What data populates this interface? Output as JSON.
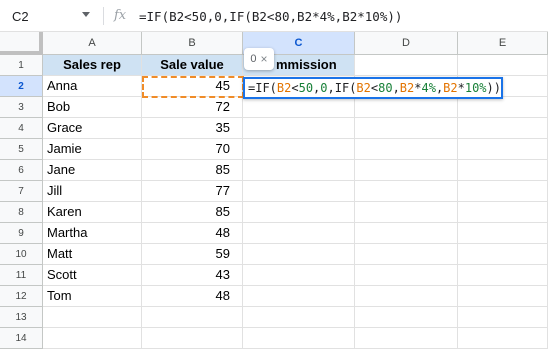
{
  "formula_bar": {
    "cell_ref": "C2",
    "fx_label": "fx",
    "formula": "=IF(B2<50,0,IF(B2<80,B2*4%,B2*10%))"
  },
  "columns": [
    "A",
    "B",
    "C",
    "D",
    "E"
  ],
  "rows": [
    "1",
    "2",
    "3",
    "4",
    "5",
    "6",
    "7",
    "8",
    "9",
    "10",
    "11",
    "12",
    "13",
    "14"
  ],
  "active": {
    "column": "C",
    "row": "2"
  },
  "table": {
    "headers": [
      "Sales rep",
      "Sale value",
      "Commission"
    ],
    "commission_header_visible": "mmission",
    "data": [
      [
        "Anna",
        "45"
      ],
      [
        "Bob",
        "72"
      ],
      [
        "Grace",
        "35"
      ],
      [
        "Jamie",
        "70"
      ],
      [
        "Jane",
        "85"
      ],
      [
        "Jill",
        "77"
      ],
      [
        "Karen",
        "85"
      ],
      [
        "Martha",
        "48"
      ],
      [
        "Matt",
        "59"
      ],
      [
        "Scott",
        "43"
      ],
      [
        "Tom",
        "48"
      ]
    ]
  },
  "editor": {
    "tokens": [
      {
        "t": "=IF(",
        "k": "plain"
      },
      {
        "t": "B2",
        "k": "ref"
      },
      {
        "t": "<",
        "k": "plain"
      },
      {
        "t": "50",
        "k": "num"
      },
      {
        "t": ",",
        "k": "plain"
      },
      {
        "t": "0",
        "k": "num"
      },
      {
        "t": ",IF(",
        "k": "plain"
      },
      {
        "t": "B2",
        "k": "ref"
      },
      {
        "t": "<",
        "k": "plain"
      },
      {
        "t": "80",
        "k": "num"
      },
      {
        "t": ",",
        "k": "plain"
      },
      {
        "t": "B2",
        "k": "ref"
      },
      {
        "t": "*",
        "k": "plain"
      },
      {
        "t": "4%",
        "k": "num"
      },
      {
        "t": ",",
        "k": "plain"
      },
      {
        "t": "B2",
        "k": "ref"
      },
      {
        "t": "*",
        "k": "plain"
      },
      {
        "t": "10%",
        "k": "num"
      },
      {
        "t": "))",
        "k": "plain"
      }
    ]
  },
  "value_chip": {
    "value": "0",
    "close": "×"
  },
  "colors": {
    "header_fill": "#cfe2f3",
    "active_header": "#d3e3fd",
    "editor_border": "#1a73e8",
    "reference": "#e37400",
    "number": "#188038"
  },
  "icons": {
    "dropdown": "chevron-down-icon",
    "chip_close": "close-icon"
  }
}
